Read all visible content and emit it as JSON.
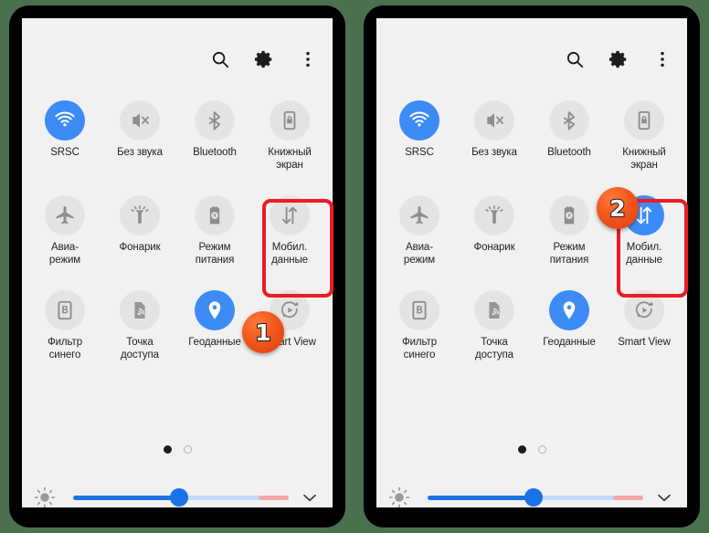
{
  "meta": {
    "background_color": "#4a7050",
    "screen_background": "#f1f1f1",
    "accent_blue": "#3d8bf5",
    "highlight_red": "#ed1b24",
    "badge_orange": "#f2571c"
  },
  "header": {
    "search_icon": "search-icon",
    "settings_icon": "gear-icon",
    "overflow_icon": "more-vertical-icon"
  },
  "tiles": [
    {
      "id": "srsc",
      "label": "SRSC",
      "icon": "wifi-icon",
      "active_left": true,
      "active_right": true
    },
    {
      "id": "mute",
      "label": "Без звука",
      "icon": "mute-icon",
      "active_left": false,
      "active_right": false
    },
    {
      "id": "bluetooth",
      "label": "Bluetooth",
      "icon": "bluetooth-icon",
      "active_left": false,
      "active_right": false
    },
    {
      "id": "portrait",
      "label": "Книжный\nэкран",
      "icon": "screen-rotation-lock-icon",
      "active_left": false,
      "active_right": false
    },
    {
      "id": "airplane",
      "label": "Авиа-\nрежим",
      "icon": "airplane-icon",
      "active_left": false,
      "active_right": false
    },
    {
      "id": "flashlight",
      "label": "Фонарик",
      "icon": "flashlight-icon",
      "active_left": false,
      "active_right": false
    },
    {
      "id": "power-mode",
      "label": "Режим\nпитания",
      "icon": "battery-eco-icon",
      "active_left": false,
      "active_right": false
    },
    {
      "id": "mobile-data",
      "label": "Мобил.\nданные",
      "icon": "data-transfer-icon",
      "active_left": false,
      "active_right": true
    },
    {
      "id": "blue-filter",
      "label": "Фильтр\nсинего",
      "icon": "blue-light-filter-icon",
      "active_left": false,
      "active_right": false
    },
    {
      "id": "hotspot",
      "label": "Точка\nдоступа",
      "icon": "hotspot-icon",
      "active_left": false,
      "active_right": false
    },
    {
      "id": "location",
      "label": "Геоданные",
      "icon": "location-pin-icon",
      "active_left": true,
      "active_right": true
    },
    {
      "id": "smart-view",
      "label": "Smart View",
      "icon": "smart-view-icon",
      "active_left": false,
      "active_right": false
    }
  ],
  "pager": {
    "total": 2,
    "current": 1
  },
  "brightness": {
    "sun_icon": "brightness-icon",
    "value_percent": 49,
    "warm_start_percent": 86,
    "expand_icon": "chevron-down-icon"
  },
  "annotations": {
    "step_one": "1",
    "step_two": "2"
  }
}
